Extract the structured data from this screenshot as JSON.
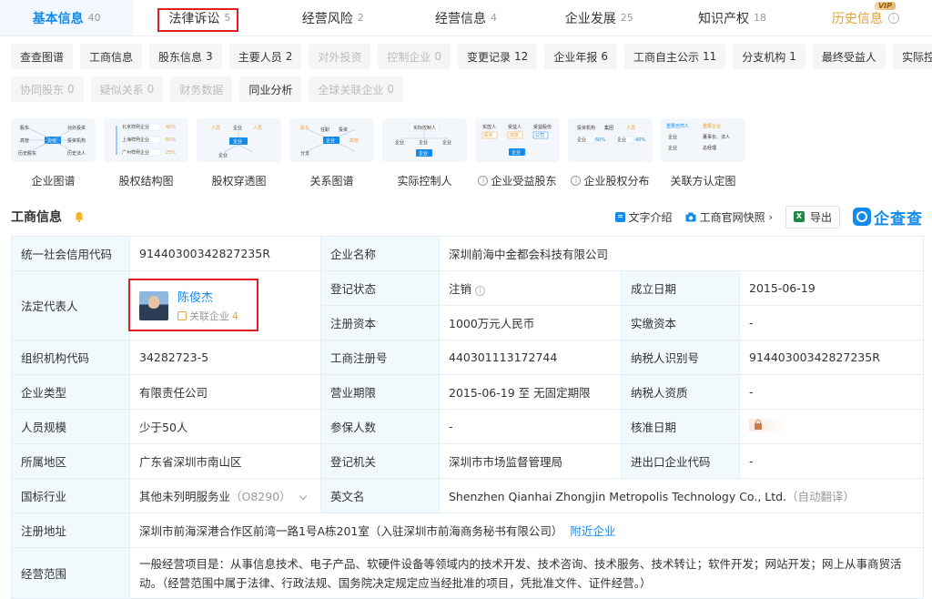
{
  "top_tabs": [
    {
      "label": "基本信息",
      "count": "40"
    },
    {
      "label": "法律诉讼",
      "count": "5"
    },
    {
      "label": "经营风险",
      "count": "2"
    },
    {
      "label": "经营信息",
      "count": "4"
    },
    {
      "label": "企业发展",
      "count": "25"
    },
    {
      "label": "知识产权",
      "count": "18"
    },
    {
      "label": "历史信息",
      "count": "",
      "badge": "VIP"
    }
  ],
  "sub_tabs_row1": [
    {
      "label": "查查图谱",
      "count": ""
    },
    {
      "label": "工商信息",
      "count": ""
    },
    {
      "label": "股东信息",
      "count": "3"
    },
    {
      "label": "主要人员",
      "count": "2"
    },
    {
      "label": "对外投资",
      "count": ""
    },
    {
      "label": "控制企业",
      "count": "0"
    },
    {
      "label": "变更记录",
      "count": "12"
    },
    {
      "label": "企业年报",
      "count": "6"
    },
    {
      "label": "工商自主公示",
      "count": "11"
    },
    {
      "label": "分支机构",
      "count": "1"
    },
    {
      "label": "最终受益人",
      "count": ""
    },
    {
      "label": "实际控制人",
      "count": ""
    }
  ],
  "sub_tabs_row2": [
    {
      "label": "协同股东",
      "count": "0"
    },
    {
      "label": "疑似关系",
      "count": "0"
    },
    {
      "label": "财务数据",
      "count": ""
    },
    {
      "label": "同业分析",
      "count": ""
    },
    {
      "label": "全球关联企业",
      "count": "0"
    }
  ],
  "graph_cards": [
    {
      "label": "企业图谱",
      "info": false
    },
    {
      "label": "股权结构图",
      "info": false
    },
    {
      "label": "股权穿透图",
      "info": false
    },
    {
      "label": "关系图谱",
      "info": false
    },
    {
      "label": "实际控制人",
      "info": false
    },
    {
      "label": "企业受益股东",
      "info": true
    },
    {
      "label": "企业股权分布",
      "info": true
    },
    {
      "label": "关联方认定图",
      "info": false
    }
  ],
  "graph_thumb_text": {
    "g1": [
      "股东",
      "对外投资",
      "高管",
      "企业",
      "投资机构",
      "历史股东",
      "历史法人"
    ],
    "g2": [
      "北京样例企业",
      "上海样例企业",
      "广州样例企业",
      "40%",
      "60%",
      "25%"
    ],
    "g3": [
      "人员",
      "企业",
      "人员",
      "企业",
      "企业"
    ],
    "g4": [
      "股东",
      "任职",
      "投资",
      "企业",
      "高管",
      "分支"
    ],
    "g5": [
      "实际控制人",
      "企业",
      "企业",
      "企业",
      "企业"
    ],
    "g6": [
      "实控人",
      "受益人",
      "受益股份",
      "股东",
      "高管",
      "公司",
      "企业"
    ],
    "g7": [
      "投资机构",
      "集团",
      "人员",
      "企业",
      "60%",
      "企业",
      "40%"
    ],
    "g8": [
      "重要自然人",
      "重要企业",
      "企业",
      "董事长、法人",
      "企业",
      "总经理"
    ]
  },
  "section": {
    "title": "工商信息",
    "actions": {
      "text_intro": "文字介绍",
      "official_snapshot": "工商官网快照",
      "export": "导出"
    },
    "brand": "企查查"
  },
  "info": {
    "credit_code_label": "统一社会信用代码",
    "credit_code": "91440300342827235R",
    "company_name_label": "企业名称",
    "company_name": "深圳前海中金都会科技有限公司",
    "legal_rep_label": "法定代表人",
    "legal_rep_name": "陈俊杰",
    "legal_rep_assoc_label": "关联企业",
    "legal_rep_assoc_count": "4",
    "status_label": "登记状态",
    "status": "注销",
    "founded_label": "成立日期",
    "founded": "2015-06-19",
    "reg_capital_label": "注册资本",
    "reg_capital": "1000万元人民币",
    "paid_capital_label": "实缴资本",
    "paid_capital": "-",
    "org_code_label": "组织机构代码",
    "org_code": "34282723-5",
    "reg_no_label": "工商注册号",
    "reg_no": "440301113172744",
    "taxpayer_id_label": "纳税人识别号",
    "taxpayer_id": "91440300342827235R",
    "company_type_label": "企业类型",
    "company_type": "有限责任公司",
    "term_label": "营业期限",
    "term": "2015-06-19 至 无固定期限",
    "taxpayer_qual_label": "纳税人资质",
    "taxpayer_qual": "-",
    "staff_size_label": "人员规模",
    "staff_size": "少于50人",
    "insured_label": "参保人数",
    "insured": "-",
    "approval_date_label": "核准日期",
    "region_label": "所属地区",
    "region": "广东省深圳市南山区",
    "reg_authority_label": "登记机关",
    "reg_authority": "深圳市市场监督管理局",
    "ie_code_label": "进出口企业代码",
    "ie_code": "-",
    "industry_label": "国标行业",
    "industry": "其他未列明服务业",
    "industry_code": "（O8290）",
    "english_name_label": "英文名",
    "english_name": "Shenzhen Qianhai Zhongjin Metropolis Technology Co., Ltd.",
    "english_name_note": "（自动翻译）",
    "address_label": "注册地址",
    "address": "深圳市前海深港合作区前湾一路1号A栋201室（入驻深圳市前海商务秘书有限公司）",
    "nearby_link": "附近企业",
    "scope_label": "经营范围",
    "scope": "一般经营项目是：从事信息技术、电子产品、软硬件设备等领域内的技术开发、技术咨询、技术服务、技术转让；软件开发；网站开发；网上从事商贸活动。（经营范围中属于法律、行政法规、国务院决定规定应当经批准的项目，凭批准文件、证件经营。）"
  },
  "colors": {
    "accent": "#128bed",
    "history": "#e6a23c",
    "highlight_box": "#e02020",
    "label_bg": "#f2f9fc"
  }
}
